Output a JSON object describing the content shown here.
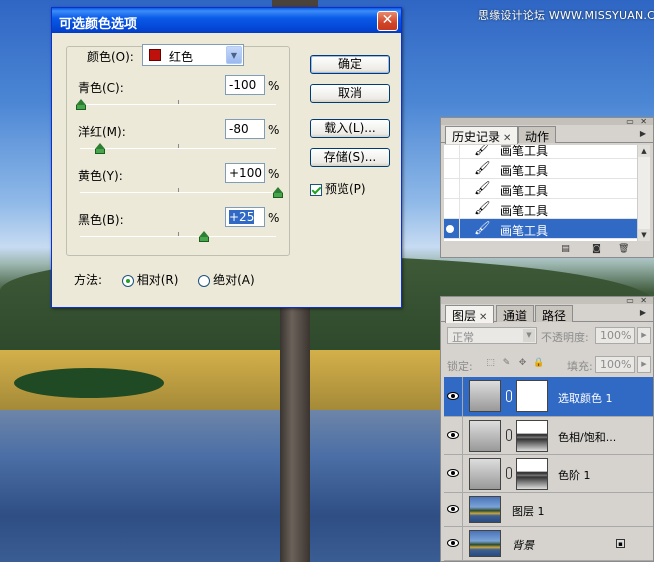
{
  "watermark": "思缘设计论坛 WWW.MISSYUAN.COM",
  "dialog": {
    "title": "可选颜色选项",
    "close_symbol": "✕",
    "color_label": "颜色(O):",
    "color_value": "红色",
    "swatch_color": "#c0100c",
    "sliders": [
      {
        "label": "青色(C):",
        "value": "-100",
        "unit": "%",
        "level": 0
      },
      {
        "label": "洋红(M):",
        "value": "-80",
        "unit": "%",
        "level": 0.1
      },
      {
        "label": "黄色(Y):",
        "value": "+100",
        "unit": "%",
        "level": 1
      },
      {
        "label": "黑色(B):",
        "value": "+25",
        "unit": "%",
        "level": 0.625
      }
    ],
    "buttons": {
      "ok": "确定",
      "cancel": "取消",
      "load": "载入(L)...",
      "save": "存储(S)..."
    },
    "preview_label": "预览(P)",
    "method_label": "方法:",
    "method_options": [
      "相对(R)",
      "绝对(A)"
    ],
    "method_selected": "相对(R)"
  },
  "history": {
    "tabs": [
      "历史记录",
      "动作"
    ],
    "items": [
      "画笔工具",
      "画笔工具",
      "画笔工具",
      "画笔工具",
      "画笔工具"
    ],
    "selected_index": 4
  },
  "layers": {
    "tabs": [
      "图层",
      "通道",
      "路径"
    ],
    "blend_mode": "正常",
    "opacity_label": "不透明度:",
    "opacity_value": "100%",
    "lock_label": "锁定:",
    "fill_label": "填充:",
    "fill_value": "100%",
    "rows": [
      {
        "name": "选取颜色 1",
        "selected": true
      },
      {
        "name": "色相/饱和...",
        "selected": false
      },
      {
        "name": "色阶 1",
        "selected": false
      },
      {
        "name": "图层 1",
        "selected": false
      },
      {
        "name": "背景",
        "selected": false
      }
    ]
  }
}
